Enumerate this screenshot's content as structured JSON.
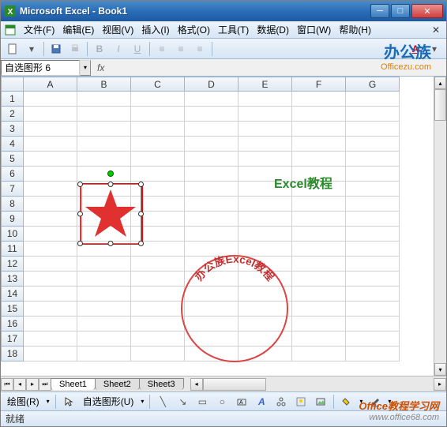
{
  "titlebar": {
    "title": "Microsoft Excel - Book1"
  },
  "menus": {
    "file": "文件(F)",
    "edit": "编辑(E)",
    "view": "视图(V)",
    "insert": "插入(I)",
    "format": "格式(O)",
    "tools": "工具(T)",
    "data": "数据(D)",
    "window": "窗口(W)",
    "help": "帮助(H)"
  },
  "formula": {
    "namebox": "自选图形 6",
    "fx": "fx"
  },
  "columns": [
    "A",
    "B",
    "C",
    "D",
    "E",
    "F",
    "G"
  ],
  "rows": [
    "1",
    "2",
    "3",
    "4",
    "5",
    "6",
    "7",
    "8",
    "9",
    "10",
    "11",
    "12",
    "13",
    "14",
    "15",
    "16",
    "17",
    "18"
  ],
  "tabs": {
    "s1": "Sheet1",
    "s2": "Sheet2",
    "s3": "Sheet3"
  },
  "drawbar": {
    "draw": "绘图(R)",
    "autoshape": "自选图形(U)"
  },
  "status": {
    "ready": "就绪"
  },
  "watermarks": {
    "brand_cn": "办公族",
    "brand_url": "Officezu.com",
    "excel_tut": "Excel教程",
    "arc_text": "办公族Excel教程",
    "footer1": "Office教程学习网",
    "footer2": "www.office68.com"
  },
  "toolbar": {
    "bold": "B",
    "italic": "I",
    "underline": "U"
  }
}
